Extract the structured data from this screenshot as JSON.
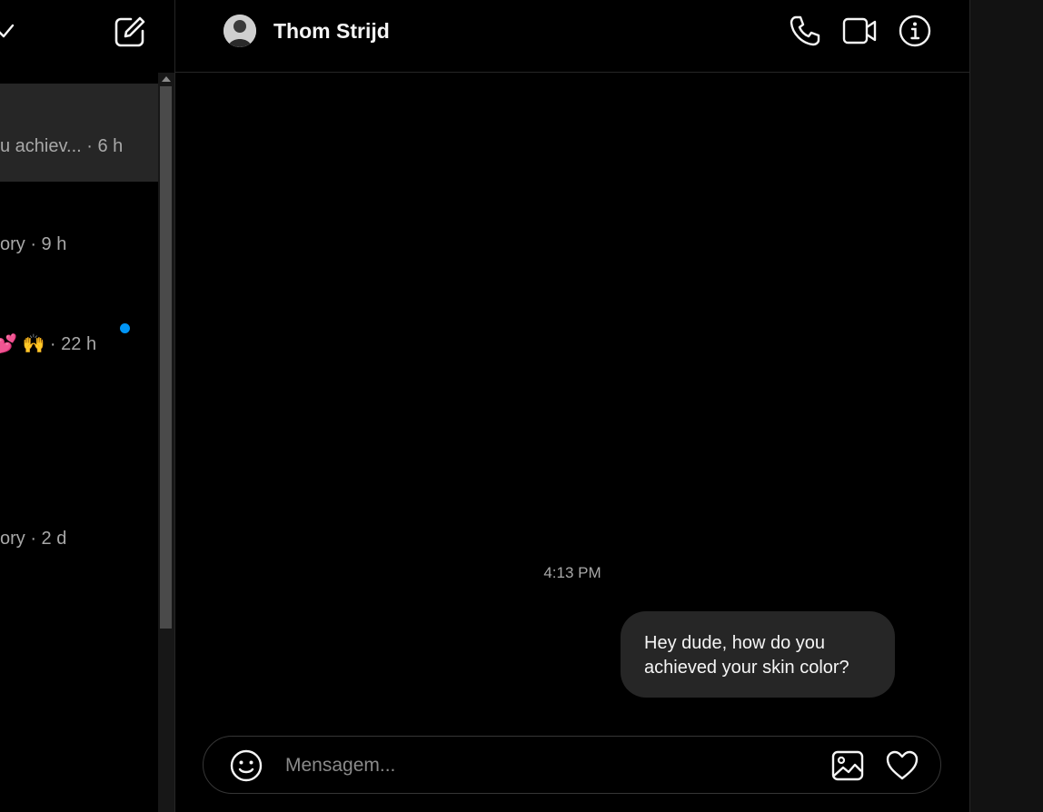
{
  "chat": {
    "contact_name": "Thom Strijd",
    "timestamp": "4:13 PM",
    "messages": [
      {
        "from": "me",
        "text": "Hey dude, how do you achieved your skin color?"
      }
    ],
    "composer": {
      "placeholder": "Mensagem..."
    }
  },
  "conversations": [
    {
      "preview": "u achiev... · 6 h",
      "active": true,
      "unread": false
    },
    {
      "preview": "ory · 9 h",
      "active": false,
      "unread": false
    },
    {
      "preview": "💕 🙌 · 22 h",
      "active": false,
      "unread": true
    },
    {
      "preview": "ory · 2 d",
      "active": false,
      "unread": false
    }
  ],
  "icons": {
    "header_left": [
      "check-icon",
      "compose-icon"
    ],
    "header_right": [
      "phone-icon",
      "video-icon",
      "info-icon"
    ],
    "composer": [
      "emoji-icon",
      "image-icon",
      "heart-icon"
    ]
  },
  "colors": {
    "background": "#000000",
    "bubble": "#262626",
    "unread_dot": "#0095f6",
    "muted_text": "#a8a8a8"
  }
}
